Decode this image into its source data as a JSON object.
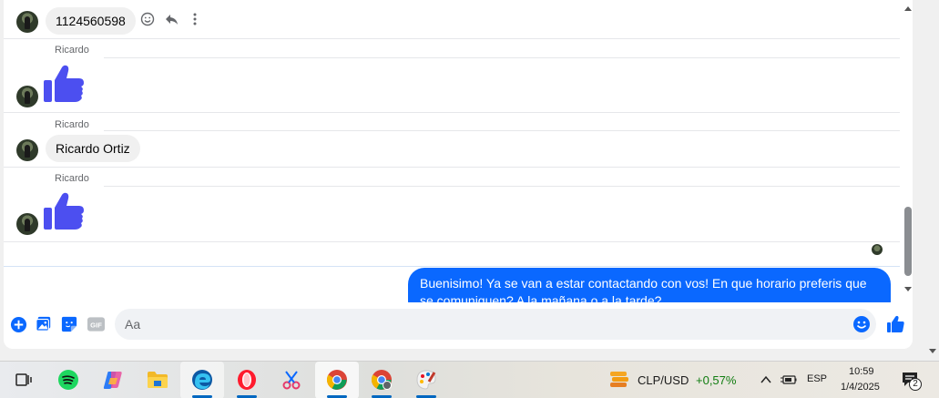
{
  "messages": [
    {
      "type": "text",
      "text": "1124560598"
    },
    {
      "type": "like",
      "sender": "Ricardo"
    },
    {
      "type": "text",
      "sender": "Ricardo",
      "text": "Ricardo Ortiz"
    },
    {
      "type": "like",
      "sender": "Ricardo"
    },
    {
      "type": "outgoing",
      "text": "Buenisimo! Ya se van a estar contactando con vos! En que horario preferis que se comuniquen? A la mañana o a la tarde?"
    }
  ],
  "composer": {
    "placeholder": "Aa"
  },
  "taskbar": {
    "apps": [
      "task-view",
      "spotify",
      "copilot",
      "file-explorer",
      "edge",
      "opera",
      "snipping",
      "chrome",
      "chrome-profile",
      "paint"
    ],
    "widget": {
      "pair": "CLP/USD",
      "change": "+0,57%"
    },
    "language": "ESP",
    "time": "10:59",
    "date": "1/4/2025",
    "notifications": "2"
  },
  "colors": {
    "accent": "#0a68ff",
    "like": "#4c4ff0",
    "positive": "#107c10"
  }
}
